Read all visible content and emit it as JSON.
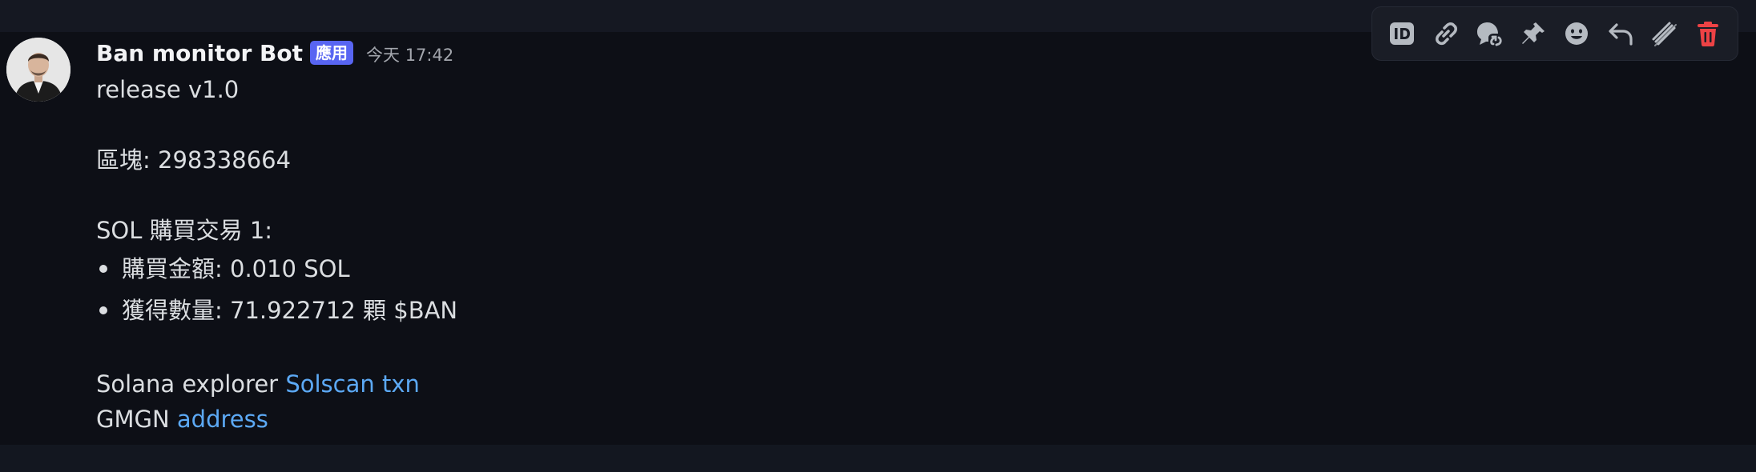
{
  "message": {
    "author": "Ban monitor Bot",
    "badge": "應用",
    "timestamp": "今天 17:42",
    "lines": {
      "release": "release v1.0",
      "block": "區塊: 298338664",
      "trade_title": "SOL 購買交易 1:",
      "buy_amount": "購買金額: 0.010 SOL",
      "received": "獲得數量: 71.922712 顆 $BAN",
      "explorer_prefix": "Solana explorer ",
      "explorer_link": "Solscan txn",
      "gmgn_prefix": "GMGN ",
      "gmgn_link": "address"
    }
  },
  "toolbar": {
    "buttons": [
      {
        "icon": "copy-id-icon"
      },
      {
        "icon": "copy-link-icon"
      },
      {
        "icon": "reply-thread-icon"
      },
      {
        "icon": "pin-icon"
      },
      {
        "icon": "add-reaction-icon"
      },
      {
        "icon": "reply-icon"
      },
      {
        "icon": "mark-unread-icon"
      },
      {
        "icon": "delete-icon",
        "color": "#ed4245"
      }
    ]
  },
  "colors": {
    "link": "#5ca9f5",
    "badge": "#5865f2",
    "delete": "#ed4245",
    "text": "#dbdee1"
  }
}
